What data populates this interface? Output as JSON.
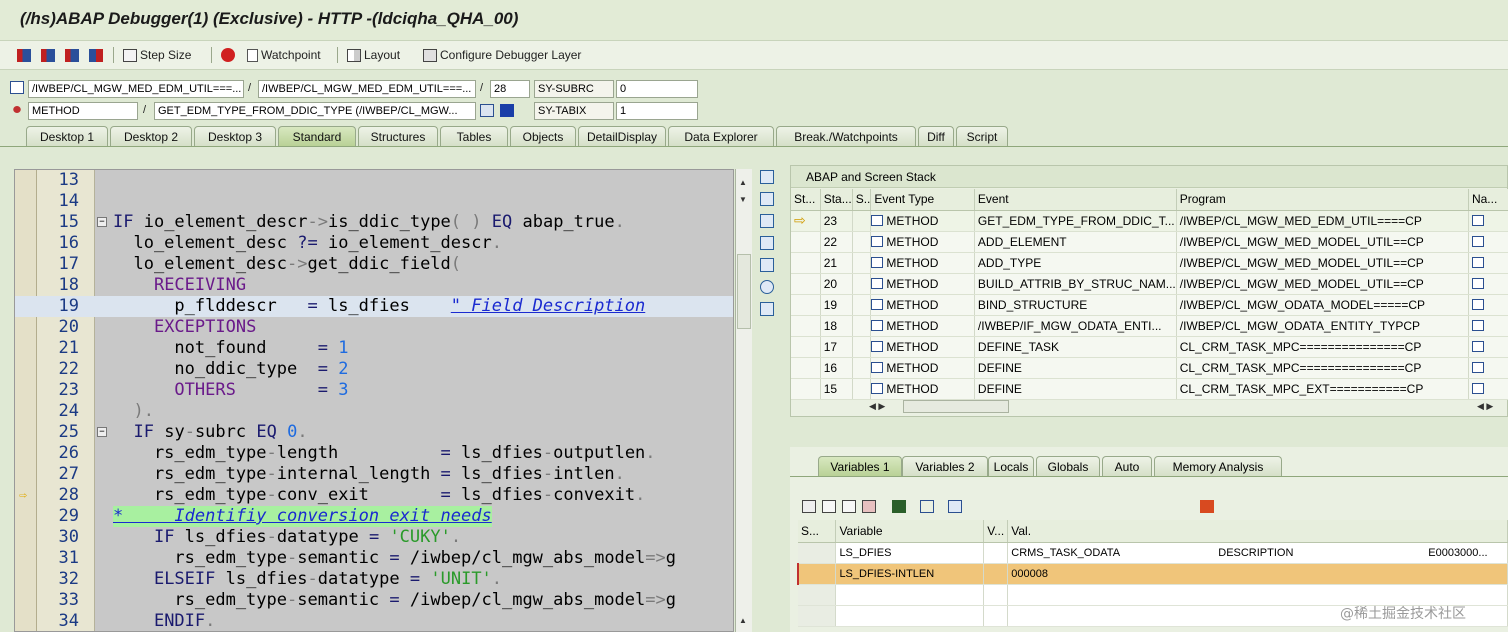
{
  "window_title": "(/hs)ABAP Debugger(1)  (Exclusive) - HTTP -(ldciqha_QHA_00)",
  "toolbar": {
    "step_size": "Step Size",
    "watchpoint": "Watchpoint",
    "layout": "Layout",
    "configure": "Configure Debugger Layer"
  },
  "context": {
    "program": "/IWBEP/CL_MGW_MED_EDM_UTIL===...",
    "include": "/IWBEP/CL_MGW_MED_EDM_UTIL===...",
    "line": "28",
    "sysubrc_label": "SY-SUBRC",
    "sysubrc_value": "0",
    "event_type": "METHOD",
    "event": "GET_EDM_TYPE_FROM_DDIC_TYPE (/IWBEP/CL_MGW...",
    "sytabix_label": "SY-TABIX",
    "sytabix_value": "1",
    "slash": "/"
  },
  "tabs": [
    "Desktop 1",
    "Desktop 2",
    "Desktop 3",
    "Standard",
    "Structures",
    "Tables",
    "Objects",
    "DetailDisplay",
    "Data Explorer",
    "Break./Watchpoints",
    "Diff",
    "Script"
  ],
  "code": {
    "lines": [
      {
        "no": "13",
        "html": ""
      },
      {
        "no": "14",
        "html": ""
      },
      {
        "no": "15",
        "html": "<span class='kw'>IF</span> io_element_descr<span class='op'>-></span>is_ddic_type<span class='op'>( )</span> <span class='kw'>EQ</span> abap_true<span class='op'>.</span>"
      },
      {
        "no": "16",
        "html": "  lo_element_desc <span class='kw'>?=</span> io_element_descr<span class='op'>.</span>"
      },
      {
        "no": "17",
        "html": "  lo_element_desc<span class='op'>-></span>get_ddic_field<span class='op'>(</span>"
      },
      {
        "no": "18",
        "html": "    <span class='mg'>RECEIVING</span>"
      },
      {
        "no": "19",
        "html": "      p_flddescr   <span class='kw'>=</span> ls_dfies    <span class='cmt'>\" Field Description</span>"
      },
      {
        "no": "20",
        "html": "    <span class='mg'>EXCEPTIONS</span>"
      },
      {
        "no": "21",
        "html": "      not_found     <span class='kw'>=</span> <span class='num'>1</span>"
      },
      {
        "no": "22",
        "html": "      no_ddic_type  <span class='kw'>=</span> <span class='num'>2</span>"
      },
      {
        "no": "23",
        "html": "      <span class='mg'>OTHERS</span>        <span class='kw'>=</span> <span class='num'>3</span>"
      },
      {
        "no": "24",
        "html": "  <span class='op'>).</span>"
      },
      {
        "no": "25",
        "html": "  <span class='kw'>IF</span> sy<span class='op'>-</span>subrc <span class='kw'>EQ</span> <span class='num'>0</span><span class='op'>.</span>"
      },
      {
        "no": "26",
        "html": "    rs_edm_type<span class='op'>-</span>length          <span class='kw'>=</span> ls_dfies<span class='op'>-</span>outputlen<span class='op'>.</span>"
      },
      {
        "no": "27",
        "html": "    rs_edm_type<span class='op'>-</span>internal_length <span class='kw'>=</span> ls_dfies<span class='op'>-</span>intlen<span class='op'>.</span>"
      },
      {
        "no": "28",
        "html": "    rs_edm_type<span class='op'>-</span>conv_exit       <span class='kw'>=</span> ls_dfies<span class='op'>-</span>convexit<span class='op'>.</span>"
      },
      {
        "no": "29",
        "html": "<span class='cmt'>*     Identifiy conversion exit needs</span>"
      },
      {
        "no": "30",
        "html": "    <span class='kw'>IF</span> ls_dfies<span class='op'>-</span>datatype <span class='kw'>=</span> <span class='str'>'CUKY'</span><span class='op'>.</span>"
      },
      {
        "no": "31",
        "html": "      rs_edm_type<span class='op'>-</span>semantic <span class='kw'>=</span> /iwbep/cl_mgw_abs_model<span class='op'>=></span>g"
      },
      {
        "no": "32",
        "html": "    <span class='kw'>ELSEIF</span> ls_dfies<span class='op'>-</span>datatype <span class='kw'>=</span> <span class='str'>'UNIT'</span><span class='op'>.</span>"
      },
      {
        "no": "33",
        "html": "      rs_edm_type<span class='op'>-</span>semantic <span class='kw'>=</span> /iwbep/cl_mgw_abs_model<span class='op'>=></span>g"
      },
      {
        "no": "34",
        "html": "    <span class='kw'>ENDIF</span><span class='op'>.</span>"
      }
    ]
  },
  "stack": {
    "title": "ABAP and Screen Stack",
    "headers": [
      "St...",
      "Sta...",
      "S..",
      "Event Type",
      "Event",
      "Program",
      "Na..."
    ],
    "rows": [
      {
        "sta": "23",
        "type": "METHOD",
        "event": "GET_EDM_TYPE_FROM_DDIC_T...",
        "program": "/IWBEP/CL_MGW_MED_EDM_UTIL====CP"
      },
      {
        "sta": "22",
        "type": "METHOD",
        "event": "ADD_ELEMENT",
        "program": "/IWBEP/CL_MGW_MED_MODEL_UTIL==CP"
      },
      {
        "sta": "21",
        "type": "METHOD",
        "event": "ADD_TYPE",
        "program": "/IWBEP/CL_MGW_MED_MODEL_UTIL==CP"
      },
      {
        "sta": "20",
        "type": "METHOD",
        "event": "BUILD_ATTRIB_BY_STRUC_NAM...",
        "program": "/IWBEP/CL_MGW_MED_MODEL_UTIL==CP"
      },
      {
        "sta": "19",
        "type": "METHOD",
        "event": "BIND_STRUCTURE",
        "program": "/IWBEP/CL_MGW_ODATA_MODEL=====CP"
      },
      {
        "sta": "18",
        "type": "METHOD",
        "event": "/IWBEP/IF_MGW_ODATA_ENTI...",
        "program": "/IWBEP/CL_MGW_ODATA_ENTITY_TYPCP"
      },
      {
        "sta": "17",
        "type": "METHOD",
        "event": "DEFINE_TASK",
        "program": "CL_CRM_TASK_MPC===============CP"
      },
      {
        "sta": "16",
        "type": "METHOD",
        "event": "DEFINE",
        "program": "CL_CRM_TASK_MPC===============CP"
      },
      {
        "sta": "15",
        "type": "METHOD",
        "event": "DEFINE",
        "program": "CL_CRM_TASK_MPC_EXT===========CP"
      }
    ]
  },
  "vartabs": [
    "Variables 1",
    "Variables 2",
    "Locals",
    "Globals",
    "Auto",
    "Memory Analysis"
  ],
  "vars": {
    "headers": [
      "S...",
      "Variable",
      "V...",
      "Val."
    ],
    "rows": [
      {
        "name": "LS_DFIES",
        "val": "CRMS_TASK_ODATA",
        "val2": "DESCRIPTION",
        "val3": "E0003000..."
      },
      {
        "name": "LS_DFIES-INTLEN",
        "val": "000008",
        "val2": "",
        "val3": ""
      },
      {
        "name": "",
        "val": "",
        "val2": "",
        "val3": ""
      },
      {
        "name": "",
        "val": "",
        "val2": "",
        "val3": ""
      }
    ]
  },
  "watermark": "@稀土掘金技术社区"
}
